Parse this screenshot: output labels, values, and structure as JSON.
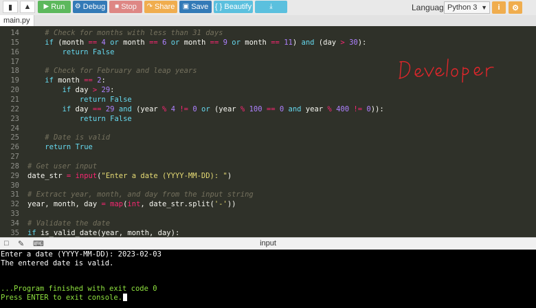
{
  "toolbar": {
    "run_label": "Run",
    "debug_label": "Debug",
    "stop_label": "Stop",
    "share_label": "Share",
    "save_label": "Save",
    "beautify_label": "{ } Beautify",
    "language_label": "Language",
    "language_value": "Python 3"
  },
  "tabs": [
    "main.py"
  ],
  "watermark": "Developer",
  "code_lines": [
    {
      "n": "14",
      "t": "    # Check for months with less than 31 days"
    },
    {
      "n": "15",
      "t": "    if (month == 4 or month == 6 or month == 9 or month == 11) and (day > 30):"
    },
    {
      "n": "16",
      "t": "        return False"
    },
    {
      "n": "17",
      "t": ""
    },
    {
      "n": "18",
      "t": "    # Check for February and leap years"
    },
    {
      "n": "19",
      "t": "    if month == 2:"
    },
    {
      "n": "20",
      "t": "        if day > 29:"
    },
    {
      "n": "21",
      "t": "            return False"
    },
    {
      "n": "22",
      "t": "        if day == 29 and (year % 4 != 0 or (year % 100 == 0 and year % 400 != 0)):"
    },
    {
      "n": "23",
      "t": "            return False"
    },
    {
      "n": "24",
      "t": ""
    },
    {
      "n": "25",
      "t": "    # Date is valid"
    },
    {
      "n": "26",
      "t": "    return True"
    },
    {
      "n": "27",
      "t": ""
    },
    {
      "n": "28",
      "t": "# Get user input"
    },
    {
      "n": "29",
      "t": "date_str = input(\"Enter a date (YYYY-MM-DD): \")"
    },
    {
      "n": "30",
      "t": ""
    },
    {
      "n": "31",
      "t": "# Extract year, month, and day from the input string"
    },
    {
      "n": "32",
      "t": "year, month, day = map(int, date_str.split('-'))"
    },
    {
      "n": "33",
      "t": ""
    },
    {
      "n": "34",
      "t": "# Validate the date"
    },
    {
      "n": "35",
      "t": "if is_valid_date(year, month, day):"
    }
  ],
  "console_title": "input",
  "console_lines": [
    {
      "t": "Enter a date (YYYY-MM-DD): 2023-02-03",
      "cls": "w"
    },
    {
      "t": "The entered date is valid.",
      "cls": "w"
    },
    {
      "t": "",
      "cls": "w"
    },
    {
      "t": "",
      "cls": "w"
    },
    {
      "t": "...Program finished with exit code 0",
      "cls": "g"
    },
    {
      "t": "Press ENTER to exit console.",
      "cls": "g"
    }
  ]
}
